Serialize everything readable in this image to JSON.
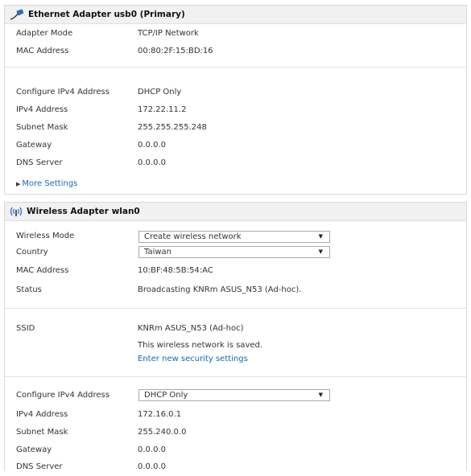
{
  "ethernet": {
    "title": "Ethernet Adapter usb0 (Primary)",
    "icon": "ethernet-plug-icon",
    "rows_top": [
      {
        "label": "Adapter Mode",
        "value": "TCP/IP Network"
      },
      {
        "label": "MAC Address",
        "value": "00:80:2F:15:BD:16"
      }
    ],
    "rows_ip": [
      {
        "label": "Configure IPv4 Address",
        "value": "DHCP Only"
      },
      {
        "label": "IPv4 Address",
        "value": "172.22.11.2"
      },
      {
        "label": "Subnet Mask",
        "value": "255.255.255.248"
      },
      {
        "label": "Gateway",
        "value": "0.0.0.0"
      },
      {
        "label": "DNS Server",
        "value": "0.0.0.0"
      }
    ],
    "more_settings": "More Settings"
  },
  "wireless": {
    "title": "Wireless Adapter wlan0",
    "icon": "wireless-signal-icon",
    "wireless_mode": {
      "label": "Wireless Mode",
      "value": "Create wireless network"
    },
    "country": {
      "label": "Country",
      "value": "Taiwan"
    },
    "mac": {
      "label": "MAC Address",
      "value": "10:BF:48:5B:54:AC"
    },
    "status": {
      "label": "Status",
      "value": "Broadcasting KNRm ASUS_N53 (Ad-hoc)."
    },
    "ssid": {
      "label": "SSID",
      "value": "KNRm ASUS_N53 (Ad-hoc)",
      "saved_note": "This wireless network is saved.",
      "security_link": "Enter new security settings"
    },
    "configure_ipv4": {
      "label": "Configure IPv4 Address",
      "value": "DHCP Only"
    },
    "ipv4": {
      "label": "IPv4 Address",
      "value": "172.16.0.1"
    },
    "subnet": {
      "label": "Subnet Mask",
      "value": "255.240.0.0"
    },
    "gateway": {
      "label": "Gateway",
      "value": "0.0.0.0"
    },
    "dns": {
      "label": "DNS Server",
      "value": "0.0.0.0"
    }
  },
  "colors": {
    "link": "#1a66b5",
    "header_bg": "#f1f1f1",
    "separator": "#e3e3e3",
    "icon_accent": "#2b6fd6"
  }
}
